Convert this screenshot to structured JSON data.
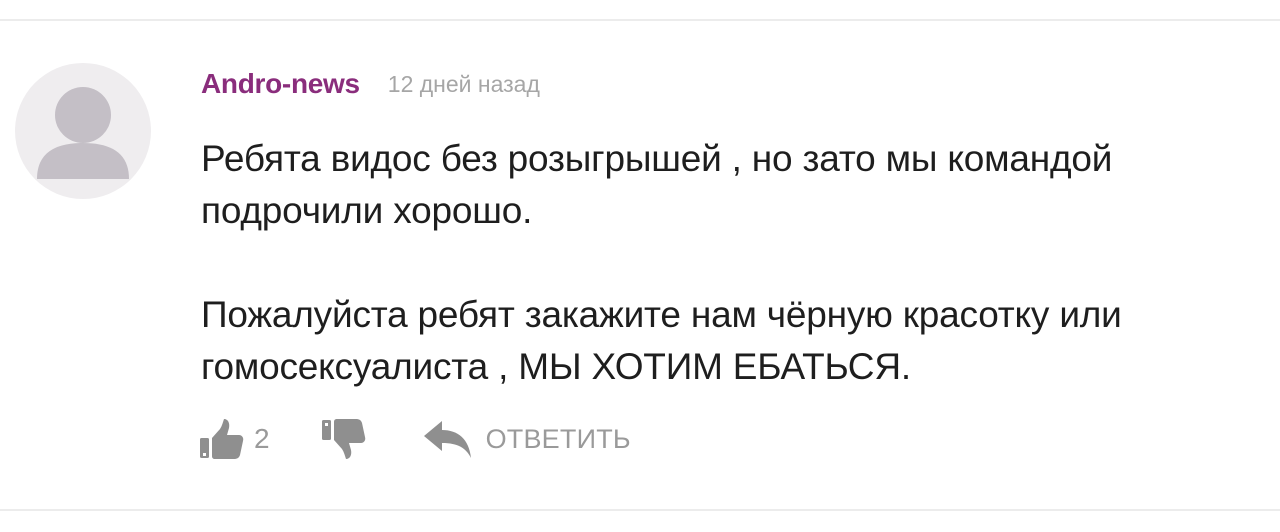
{
  "comment": {
    "author": "Andro-news",
    "time": "12 дней назад",
    "paragraphs": [
      "Ребята видос без розыгрышей , но зато мы командой\nподрочили хорошо.",
      "Пожалуйста ребят закажите нам чёрную красотку или\nгомосексуалиста , МЫ ХОТИМ ЕБАТЬСЯ."
    ],
    "likes": "2",
    "reply_label": "ОТВЕТИТЬ"
  },
  "icons": {
    "avatar": "user-placeholder-icon",
    "like": "thumbs-up-icon",
    "dislike": "thumbs-down-icon",
    "reply": "reply-arrow-icon"
  },
  "colors": {
    "author": "#8a2d7c",
    "meta": "#a6a6a6",
    "text": "#1e1e1e",
    "icon": "#8f8f8f",
    "avatar_bg": "#efedef",
    "avatar_fg": "#c4bfc6"
  }
}
